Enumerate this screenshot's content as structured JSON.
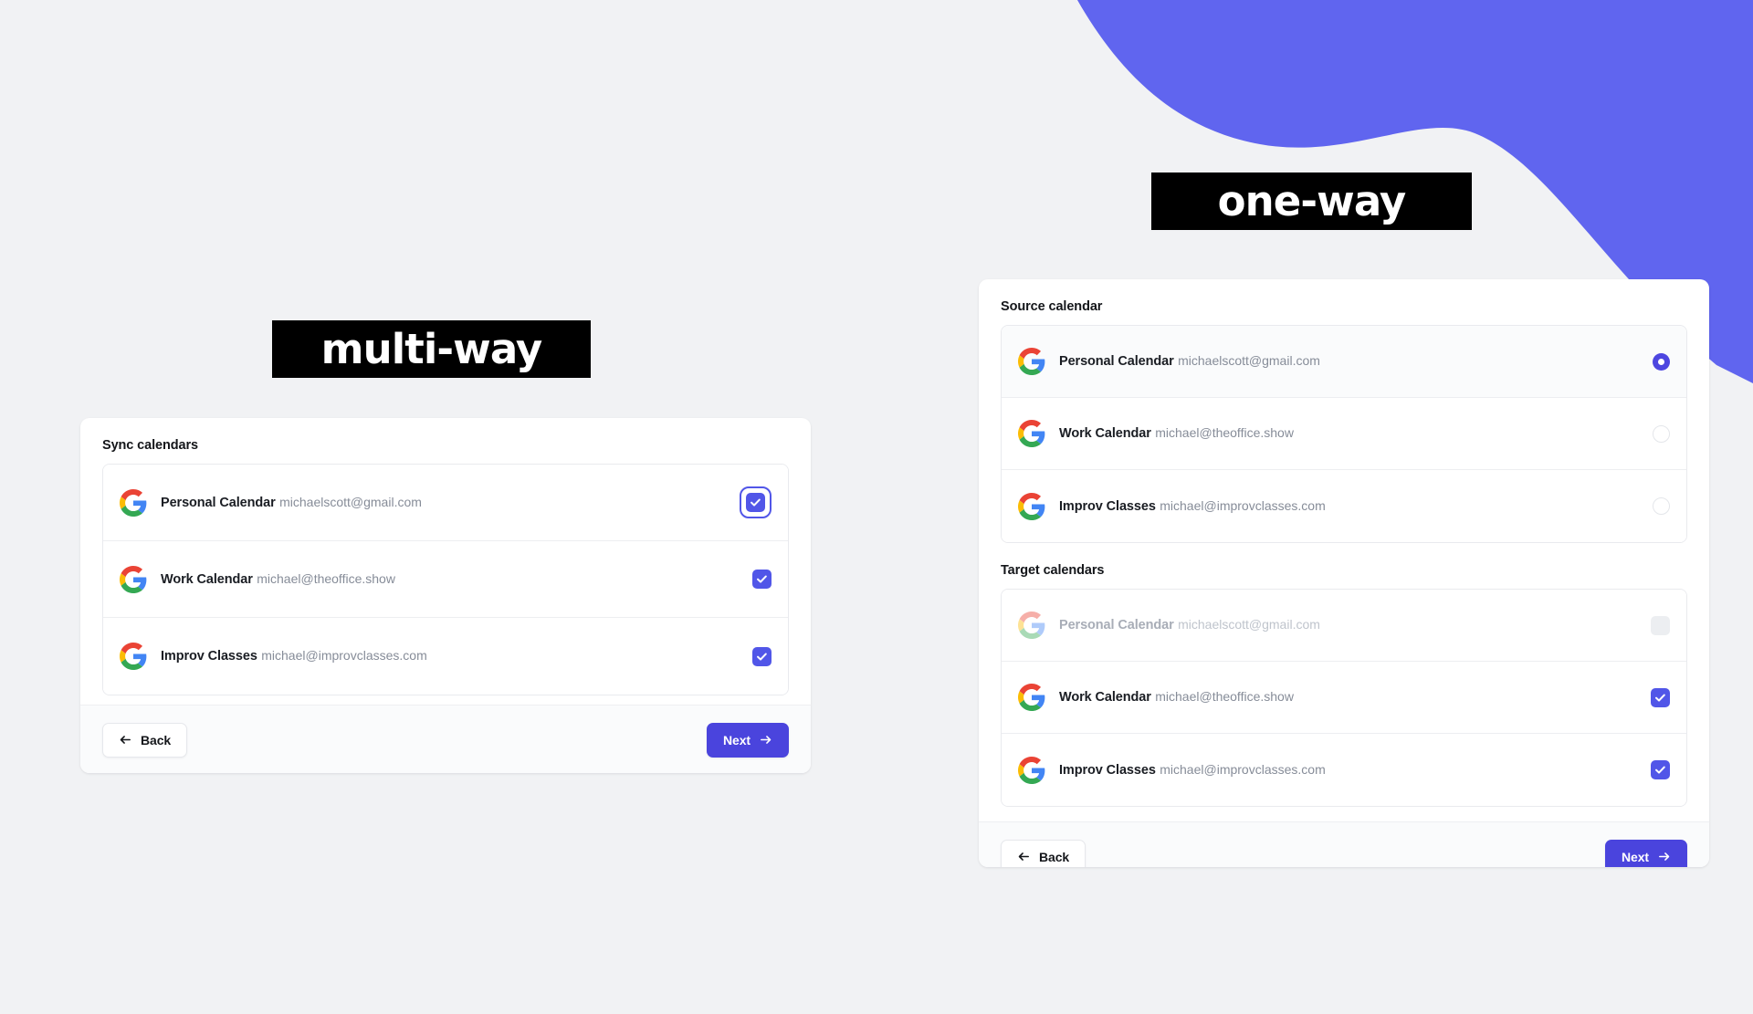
{
  "page": {
    "background_color": "#f1f2f4",
    "accent_purple": "#6065ef",
    "button_purple": "#4a44dd",
    "checkbox_purple": "#5156e8"
  },
  "decor": {
    "wave_name": "purple-wave-shape",
    "wave_color": "#6065ef"
  },
  "badges": {
    "multi_way": "multi-way",
    "one_way": "one-way"
  },
  "left_card": {
    "section_title": "Sync calendars",
    "rows": [
      {
        "name": "Personal Calendar",
        "email": "michaelscott@gmail.com",
        "control": "checkbox",
        "checked": true,
        "focused": true,
        "disabled": false
      },
      {
        "name": "Work Calendar",
        "email": "michael@theoffice.show",
        "control": "checkbox",
        "checked": true,
        "focused": false,
        "disabled": false
      },
      {
        "name": "Improv Classes",
        "email": "michael@improvclasses.com",
        "control": "checkbox",
        "checked": true,
        "focused": false,
        "disabled": false
      }
    ],
    "footer": {
      "back_label": "Back",
      "next_label": "Next",
      "back_icon": "arrow-left-icon",
      "next_icon": "arrow-right-icon"
    }
  },
  "right_card": {
    "source_title": "Source calendar",
    "target_title": "Target calendars",
    "source_rows": [
      {
        "name": "Personal Calendar",
        "email": "michaelscott@gmail.com",
        "control": "radio",
        "selected": true,
        "disabled": false
      },
      {
        "name": "Work Calendar",
        "email": "michael@theoffice.show",
        "control": "radio",
        "selected": false,
        "disabled": false
      },
      {
        "name": "Improv Classes",
        "email": "michael@improvclasses.com",
        "control": "radio",
        "selected": false,
        "disabled": false
      }
    ],
    "target_rows": [
      {
        "name": "Personal Calendar",
        "email": "michaelscott@gmail.com",
        "control": "checkbox",
        "checked": false,
        "disabled": true
      },
      {
        "name": "Work Calendar",
        "email": "michael@theoffice.show",
        "control": "checkbox",
        "checked": true,
        "disabled": false
      },
      {
        "name": "Improv Classes",
        "email": "michael@improvclasses.com",
        "control": "checkbox",
        "checked": true,
        "disabled": false
      }
    ],
    "footer": {
      "back_label": "Back",
      "next_label": "Next",
      "back_icon": "arrow-left-icon",
      "next_icon": "arrow-right-icon"
    }
  },
  "icons": {
    "google_logo": "google-g-icon",
    "check": "check-icon"
  }
}
